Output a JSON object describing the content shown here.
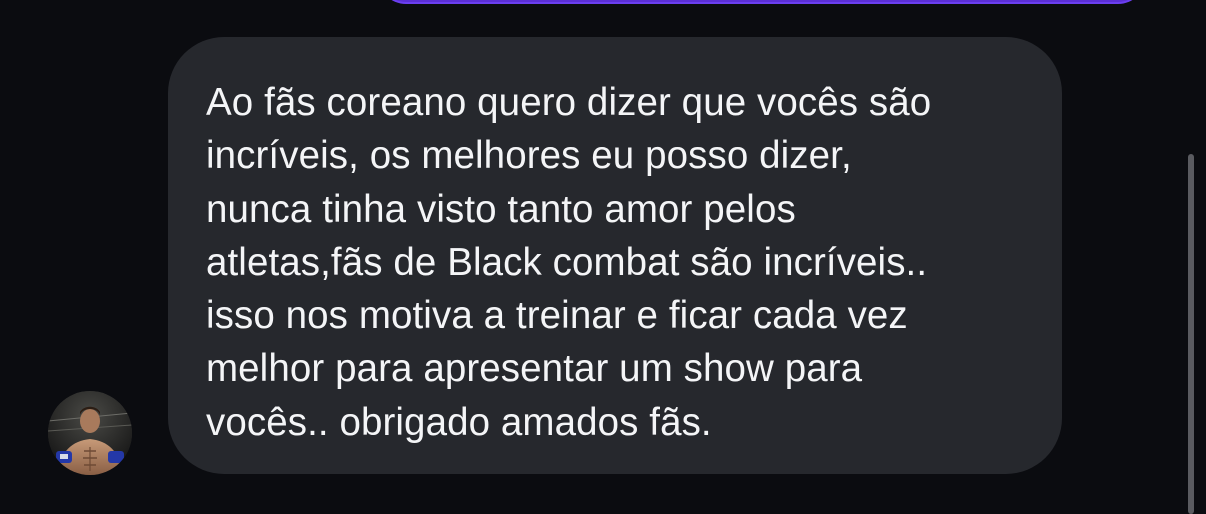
{
  "conversation": {
    "incoming_message": {
      "sender_avatar_icon": "fighter-avatar-icon",
      "text": "Ao fãs coreano quero dizer que vocês são\nincríveis,  os melhores eu posso dizer,\nnunca tinha visto tanto amor pelos\natletas,fãs de Black combat são incríveis..\nisso nos motiva a treinar e ficar cada vez\nmelhor para apresentar um show para\nvocês.. obrigado amados fãs."
    }
  },
  "colors": {
    "background": "#0b0c10",
    "incoming_bubble": "#26282d",
    "outgoing_bubble_border": "#6b3ff0",
    "text": "#f4f5f7"
  }
}
